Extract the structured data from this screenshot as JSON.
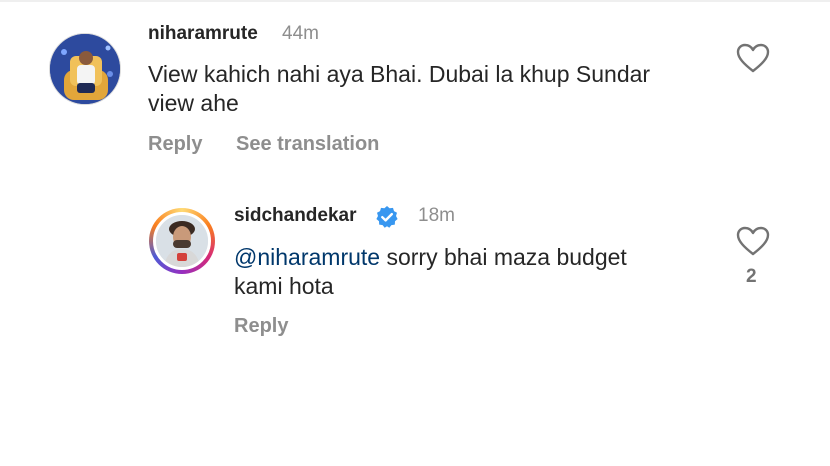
{
  "comments": [
    {
      "username": "niharamrute",
      "time": "44m",
      "text_line1": "View kahich nahi aya Bhai. Dubai la khup Sundar",
      "text_line2": "view ahe",
      "reply_label": "Reply",
      "translation_label": "See translation",
      "like_icon": "heart-outline-icon"
    },
    {
      "username": "sidchandekar",
      "verified_icon": "verified-badge-icon",
      "time": "18m",
      "mention": "@niharamrute",
      "text_line1_rest": " sorry bhai maza budget",
      "text_line2": "kami hota",
      "reply_label": "Reply",
      "like_icon": "heart-outline-icon",
      "like_count": "2"
    }
  ],
  "colors": {
    "text": "#262626",
    "secondary": "#8e8e8e",
    "mention": "#00376b",
    "verified": "#3897f0"
  }
}
